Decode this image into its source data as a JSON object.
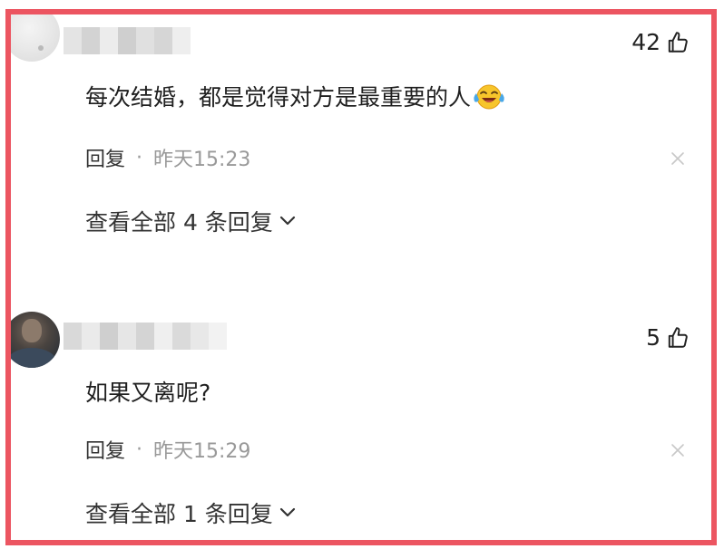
{
  "comments": [
    {
      "likes": "42",
      "text": "每次结婚，都是觉得对方是最重要的人",
      "reply_label": "回复",
      "separator": "·",
      "time": "昨天15:23",
      "view_replies": "查看全部 4 条回复",
      "emoji": "face-with-tears-of-joy-icon"
    },
    {
      "likes": "5",
      "text": "如果又离呢?",
      "reply_label": "回复",
      "separator": "·",
      "time": "昨天15:29",
      "view_replies": "查看全部 1 条回复"
    }
  ],
  "colors": {
    "frame": "#ec5561",
    "secondary_text": "#999999",
    "primary_text": "#222222"
  }
}
